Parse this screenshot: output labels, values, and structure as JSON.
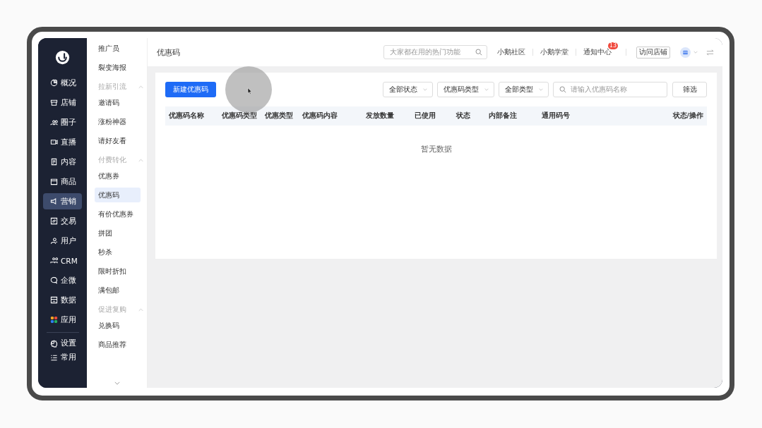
{
  "nav_rail": {
    "items": [
      {
        "label": "概况",
        "selected": false
      },
      {
        "label": "店铺",
        "selected": false
      },
      {
        "label": "圈子",
        "selected": false
      },
      {
        "label": "直播",
        "selected": false
      },
      {
        "label": "内容",
        "selected": false
      },
      {
        "label": "商品",
        "selected": false
      },
      {
        "label": "营销",
        "selected": true
      },
      {
        "label": "交易",
        "selected": false
      },
      {
        "label": "用户",
        "selected": false
      },
      {
        "label": "CRM",
        "selected": false
      },
      {
        "label": "企微",
        "selected": false
      },
      {
        "label": "数据",
        "selected": false
      },
      {
        "label": "应用",
        "selected": false
      }
    ],
    "bottom_items": [
      {
        "label": "设置"
      },
      {
        "label": "常用"
      }
    ]
  },
  "submenu": {
    "items": [
      {
        "kind": "item",
        "label": "推广员",
        "selected": false
      },
      {
        "kind": "item",
        "label": "裂变海报",
        "selected": false
      },
      {
        "kind": "group",
        "label": "拉新引流",
        "expanded": true
      },
      {
        "kind": "item",
        "label": "邀请码",
        "selected": false
      },
      {
        "kind": "item",
        "label": "涨粉神器",
        "selected": false
      },
      {
        "kind": "item",
        "label": "请好友看",
        "selected": false
      },
      {
        "kind": "group",
        "label": "付费转化",
        "expanded": true
      },
      {
        "kind": "item",
        "label": "优惠券",
        "selected": false
      },
      {
        "kind": "item",
        "label": "优惠码",
        "selected": true
      },
      {
        "kind": "item",
        "label": "有价优惠券",
        "selected": false
      },
      {
        "kind": "item",
        "label": "拼团",
        "selected": false
      },
      {
        "kind": "item",
        "label": "秒杀",
        "selected": false
      },
      {
        "kind": "item",
        "label": "限时折扣",
        "selected": false
      },
      {
        "kind": "item",
        "label": "满包邮",
        "selected": false
      },
      {
        "kind": "group",
        "label": "促进复购",
        "expanded": true
      },
      {
        "kind": "item",
        "label": "兑换码",
        "selected": false
      },
      {
        "kind": "item",
        "label": "商品推荐",
        "selected": false
      }
    ]
  },
  "header": {
    "title": "优惠码",
    "search": {
      "placeholder": "大家都在用的热门功能"
    },
    "links": [
      "小鹅社区",
      "小鹅学堂"
    ],
    "notifications": {
      "label": "通知中心",
      "badge": "13"
    },
    "visit_button": "访问店铺"
  },
  "toolbar": {
    "new_button": "新建优惠码",
    "filters": [
      {
        "value": "全部状态"
      },
      {
        "value": "优惠码类型"
      },
      {
        "value": "全部类型"
      }
    ],
    "search": {
      "placeholder": "请输入优惠码名称"
    },
    "filter_button": "筛选"
  },
  "table": {
    "columns": [
      "优惠码名称",
      "优惠码类型",
      "优惠类型",
      "优惠码内容",
      "发放数量",
      "已使用",
      "状态",
      "内部备注",
      "通用码号",
      "状态/操作"
    ],
    "empty_text": "暂无数据"
  }
}
